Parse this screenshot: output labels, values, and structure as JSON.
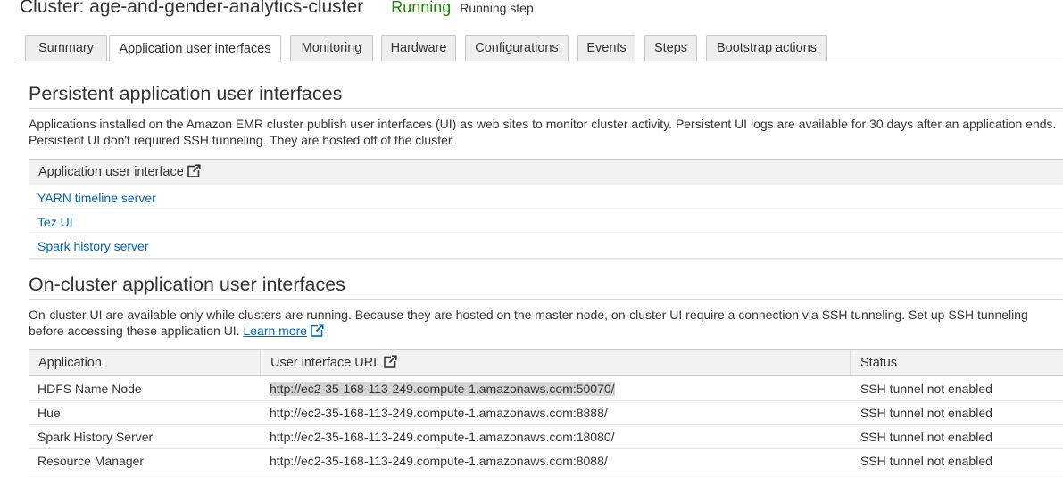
{
  "header": {
    "title": "Cluster: age-and-gender-analytics-cluster",
    "status": "Running",
    "status_detail": "Running step"
  },
  "tabs": [
    {
      "label": "Summary",
      "active": false
    },
    {
      "label": "Application user interfaces",
      "active": true
    },
    {
      "label": "Monitoring",
      "active": false
    },
    {
      "label": "Hardware",
      "active": false
    },
    {
      "label": "Configurations",
      "active": false
    },
    {
      "label": "Events",
      "active": false
    },
    {
      "label": "Steps",
      "active": false
    },
    {
      "label": "Bootstrap actions",
      "active": false
    }
  ],
  "persistent": {
    "heading": "Persistent application user interfaces",
    "description": "Applications installed on the Amazon EMR cluster publish user interfaces (UI) as web sites to monitor cluster activity. Persistent UI logs are available for 30 days after an application ends. Persistent UI don't required SSH tunneling. They are hosted off of the cluster.",
    "column_header": "Application user interface",
    "header_icon": "external-link-icon",
    "items": [
      {
        "label": "YARN timeline server"
      },
      {
        "label": "Tez UI"
      },
      {
        "label": "Spark history server"
      }
    ]
  },
  "oncluster": {
    "heading": "On-cluster application user interfaces",
    "description": "On-cluster UI are available only while clusters are running. Because they are hosted on the master node, on-cluster UI require a connection via SSH tunneling. Set up SSH tunneling before accessing these application UI.",
    "learn_more": "Learn more",
    "learn_more_icon": "external-link-icon",
    "columns": {
      "application": "Application",
      "url": "User interface URL",
      "status": "Status"
    },
    "rows": [
      {
        "application": "HDFS Name Node",
        "url": "http://ec2-35-168-113-249.compute-1.amazonaws.com:50070/",
        "status": "SSH tunnel not enabled",
        "url_selected": true
      },
      {
        "application": "Hue",
        "url": "http://ec2-35-168-113-249.compute-1.amazonaws.com:8888/",
        "status": "SSH tunnel not enabled",
        "url_selected": false
      },
      {
        "application": "Spark History Server",
        "url": "http://ec2-35-168-113-249.compute-1.amazonaws.com:18080/",
        "status": "SSH tunnel not enabled",
        "url_selected": false
      },
      {
        "application": "Resource Manager",
        "url": "http://ec2-35-168-113-249.compute-1.amazonaws.com:8088/",
        "status": "SSH tunnel not enabled",
        "url_selected": false
      }
    ]
  },
  "colors": {
    "status_running": "#1d8102",
    "link": "#0066bb",
    "text": "#333333",
    "header_bg": "#f2f2f2",
    "tab_bg": "#eeeeee"
  }
}
